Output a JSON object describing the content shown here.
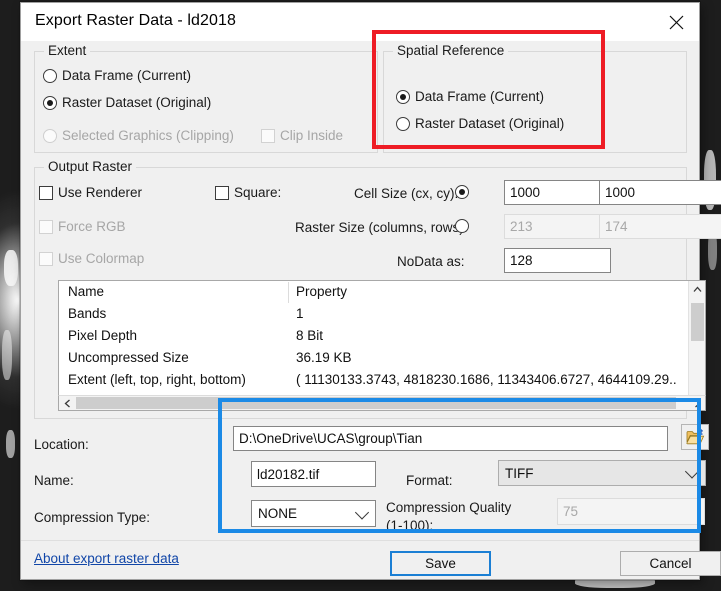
{
  "window": {
    "title": "Export Raster Data - ld2018",
    "close_icon": "close-icon"
  },
  "extent": {
    "legend": "Extent",
    "options": [
      {
        "label": "Data Frame (Current)",
        "checked": false,
        "disabled": false
      },
      {
        "label": "Raster Dataset (Original)",
        "checked": true,
        "disabled": false
      },
      {
        "label": "Selected Graphics (Clipping)",
        "checked": false,
        "disabled": true
      }
    ],
    "clip_inside": {
      "label": "Clip Inside",
      "checked": false,
      "disabled": true
    }
  },
  "spatial_reference": {
    "legend": "Spatial Reference",
    "options": [
      {
        "label": "Data Frame (Current)",
        "checked": true
      },
      {
        "label": "Raster Dataset (Original)",
        "checked": false
      }
    ]
  },
  "output_raster": {
    "legend": "Output Raster",
    "use_renderer": {
      "label": "Use Renderer",
      "checked": false,
      "disabled": false
    },
    "force_rgb": {
      "label": "Force RGB",
      "checked": false,
      "disabled": true
    },
    "use_colormap": {
      "label": "Use Colormap",
      "checked": false,
      "disabled": true
    },
    "square": {
      "label": "Square:",
      "checked": false
    },
    "cell_size_label": "Cell Size (cx, cy):",
    "cell_size_selected": true,
    "cell_size_cx": "1000",
    "cell_size_cy": "1000",
    "raster_size_label": "Raster Size (columns, rows):",
    "raster_size_selected": false,
    "raster_size_columns": "213",
    "raster_size_rows": "174",
    "nodata_label": "NoData as:",
    "nodata_value": "128"
  },
  "properties": {
    "columns": [
      "Name",
      "Property"
    ],
    "rows": [
      {
        "name": "Bands",
        "value": "1"
      },
      {
        "name": "Pixel Depth",
        "value": "8 Bit"
      },
      {
        "name": "Uncompressed Size",
        "value": "36.19 KB"
      },
      {
        "name": "Extent (left, top, right, bottom)",
        "value": "( 11130133.3743, 4818230.1686, 11343406.6727, 4644109.29.."
      }
    ]
  },
  "output": {
    "location_label": "Location:",
    "location_value": "D:\\OneDrive\\UCAS\\group\\Tian",
    "browse_icon": "folder-open-icon",
    "name_label": "Name:",
    "name_value": "ld20182.tif",
    "format_label": "Format:",
    "format_value": "TIFF",
    "compression_type_label": "Compression Type:",
    "compression_type_value": "NONE",
    "compression_quality_label_line1": "Compression Quality",
    "compression_quality_label_line2": "(1-100):",
    "compression_quality_value": "75"
  },
  "footer": {
    "help_link": "About export raster data",
    "save_label": "Save",
    "cancel_label": "Cancel"
  },
  "annotations": {
    "highlight_spatial_reference_color": "#ee1c25",
    "highlight_output_color": "#1b8ae6",
    "save_focus_color": "#1b7fd4"
  }
}
